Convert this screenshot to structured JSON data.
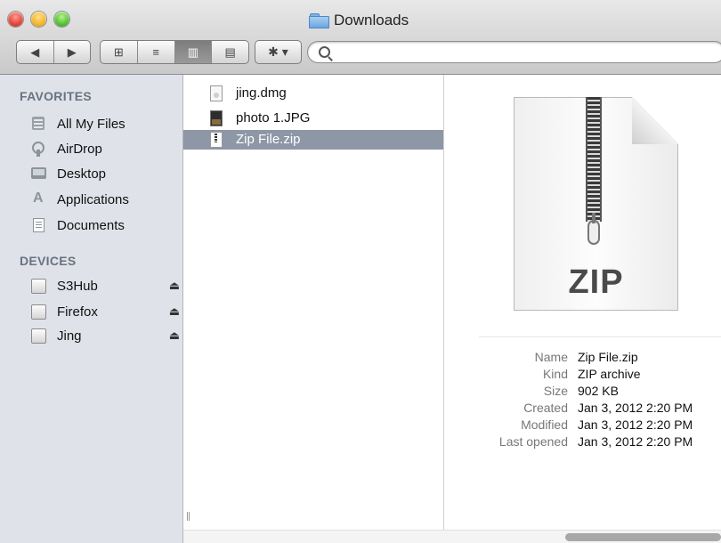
{
  "window": {
    "title": "Downloads"
  },
  "toolbar": {
    "back": "◀",
    "forward": "▶",
    "views": [
      "⊞",
      "≡",
      "▥",
      "▤"
    ],
    "action": "✱ ▾",
    "search_placeholder": ""
  },
  "sidebar": {
    "favorites_heading": "FAVORITES",
    "favorites": [
      {
        "label": "All My Files",
        "icon": "all-my-files-icon"
      },
      {
        "label": "AirDrop",
        "icon": "airdrop-icon"
      },
      {
        "label": "Desktop",
        "icon": "desktop-icon"
      },
      {
        "label": "Applications",
        "icon": "applications-icon"
      },
      {
        "label": "Documents",
        "icon": "documents-icon"
      }
    ],
    "devices_heading": "DEVICES",
    "devices": [
      {
        "label": "S3Hub",
        "icon": "disk-icon",
        "eject": "⏏"
      },
      {
        "label": "Firefox",
        "icon": "disk-icon",
        "eject": "⏏"
      },
      {
        "label": "Jing",
        "icon": "disk-icon",
        "eject": "⏏"
      }
    ]
  },
  "files": [
    {
      "name": "jing.dmg",
      "icon": "dmg-file-icon",
      "selected": false
    },
    {
      "name": "photo 1.JPG",
      "icon": "jpg-file-icon",
      "selected": false
    },
    {
      "name": "Zip File.zip",
      "icon": "zip-file-icon",
      "selected": true
    }
  ],
  "preview": {
    "icon_label": "ZIP",
    "info": [
      {
        "key": "Name",
        "value": "Zip File.zip"
      },
      {
        "key": "Kind",
        "value": "ZIP archive"
      },
      {
        "key": "Size",
        "value": "902 KB"
      },
      {
        "key": "Created",
        "value": "Jan 3, 2012 2:20 PM"
      },
      {
        "key": "Modified",
        "value": "Jan 3, 2012 2:20 PM"
      },
      {
        "key": "Last opened",
        "value": "Jan 3, 2012 2:20 PM"
      }
    ]
  },
  "colors": {
    "selection": "#8d97a6",
    "sidebar_bg": "#dfe3e9",
    "heading": "#6a7280"
  }
}
